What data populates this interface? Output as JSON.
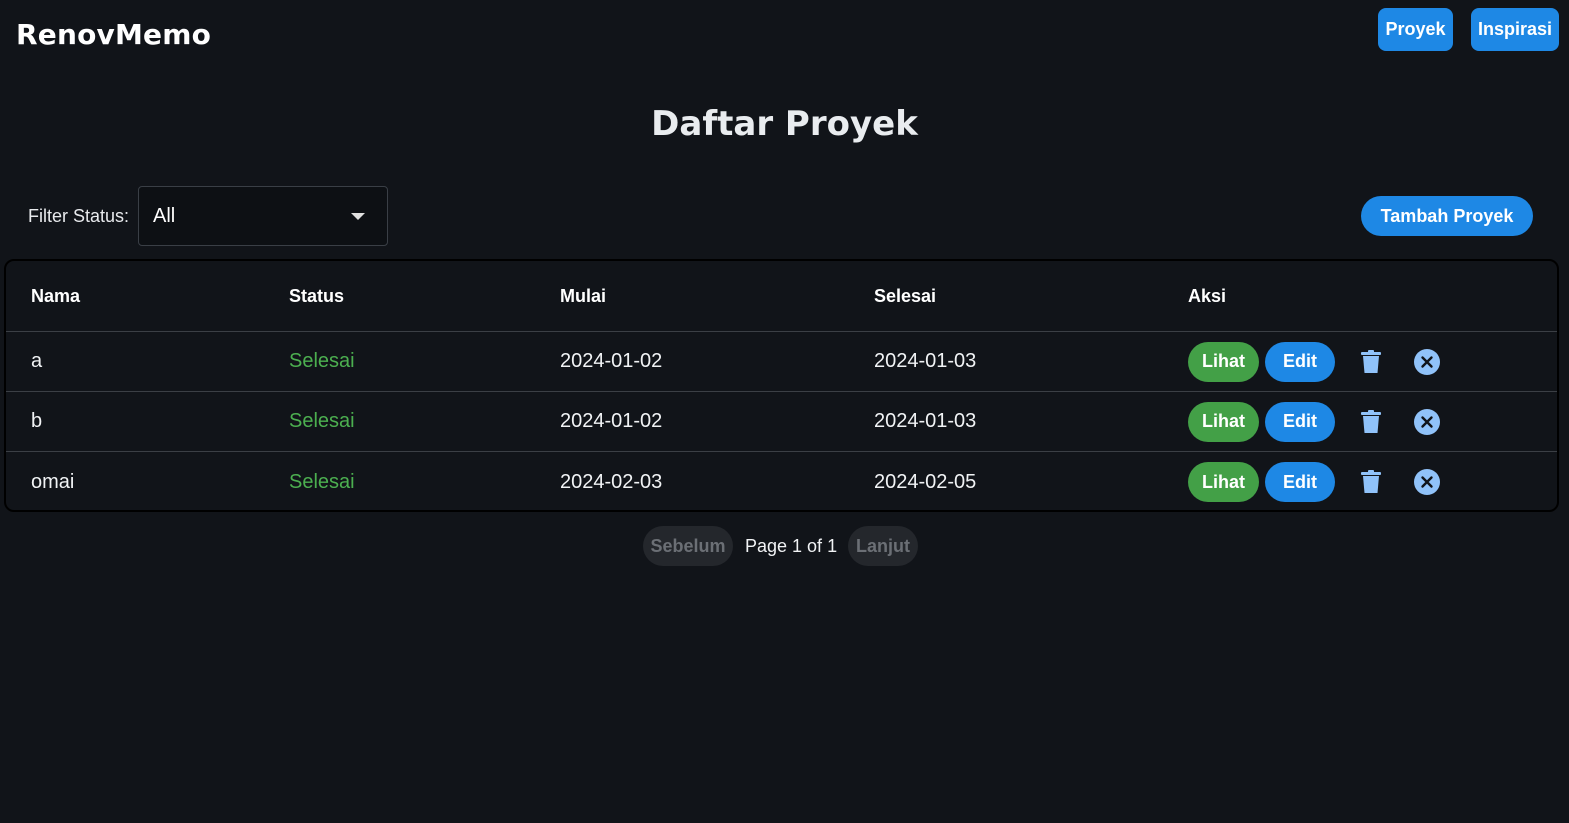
{
  "header": {
    "brand": "RenovMemo",
    "nav": [
      "Proyek",
      "Inspirasi"
    ]
  },
  "page": {
    "title": "Daftar Proyek"
  },
  "filter": {
    "label": "Filter Status:",
    "selected": "All"
  },
  "actions": {
    "add_label": "Tambah Proyek"
  },
  "table": {
    "columns": [
      "Nama",
      "Status",
      "Mulai",
      "Selesai",
      "Aksi"
    ],
    "rows": [
      {
        "nama": "a",
        "status": "Selesai",
        "mulai": "2024-01-02",
        "selesai": "2024-01-03"
      },
      {
        "nama": "b",
        "status": "Selesai",
        "mulai": "2024-01-02",
        "selesai": "2024-01-03"
      },
      {
        "nama": "omai",
        "status": "Selesai",
        "mulai": "2024-02-03",
        "selesai": "2024-02-05"
      }
    ],
    "row_actions": {
      "view_label": "Lihat",
      "edit_label": "Edit",
      "delete_icon": "trash-icon",
      "cancel_icon": "close-circle-icon"
    }
  },
  "pagination": {
    "prev_label": "Sebelum",
    "page_text": "Page 1 of 1",
    "next_label": "Lanjut"
  },
  "colors": {
    "background": "#111419",
    "primary": "#1e88e5",
    "success": "#43a047",
    "status_text": "#4caf50",
    "icon": "#90c2f9"
  }
}
